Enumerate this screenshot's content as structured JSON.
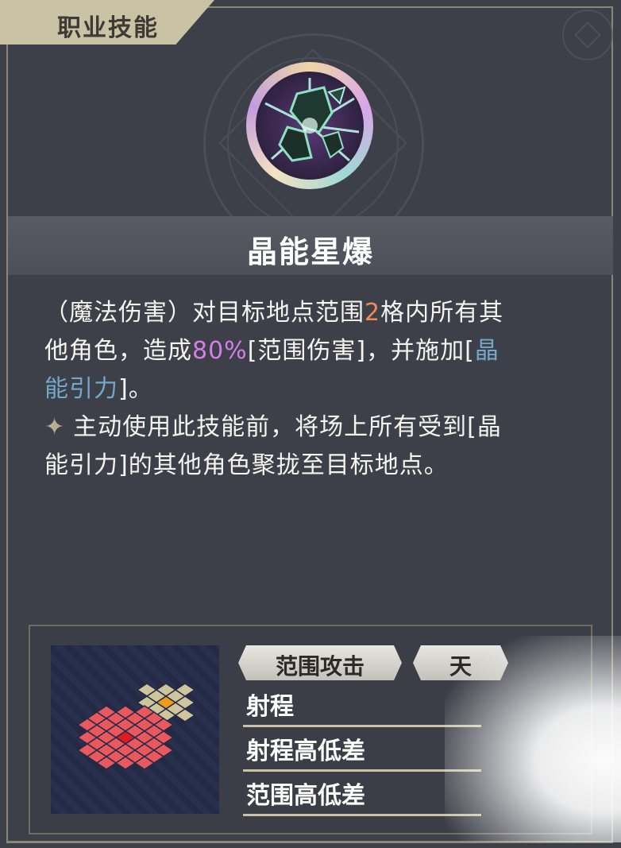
{
  "header": {
    "title": "职业技能"
  },
  "skill": {
    "name": "晶能星爆",
    "desc_line1": {
      "prefix": "（魔法伤害）对目标地点范围",
      "range": "2",
      "suffix": "格内所有其"
    },
    "desc_line2": {
      "prefix": "他角色，造成",
      "percent": "80%",
      "middle": "[范围伤害]，并施加[",
      "status_part": "晶"
    },
    "desc_line3": {
      "status_part": "能引力",
      "suffix": "]。"
    },
    "desc_line4": "主动使用此技能前，将场上所有受到[晶",
    "desc_line5": "能引力]的其他角色聚拢至目标地点。",
    "sparkle_icon": "four-point-star-icon"
  },
  "info": {
    "tags": [
      "范围攻击",
      "天"
    ],
    "stats": [
      {
        "label": "射程"
      },
      {
        "label": "射程高低差"
      },
      {
        "label": "范围高低差"
      }
    ]
  },
  "colors": {
    "range_number": "#f08a5a",
    "damage_percent": "#d47ee6",
    "status_effect": "#73a8c8",
    "grid_attack": "#e8585e",
    "grid_center": "#e01a20",
    "grid_target_area": "#cfc59c",
    "grid_target_center": "#f09a1a"
  }
}
